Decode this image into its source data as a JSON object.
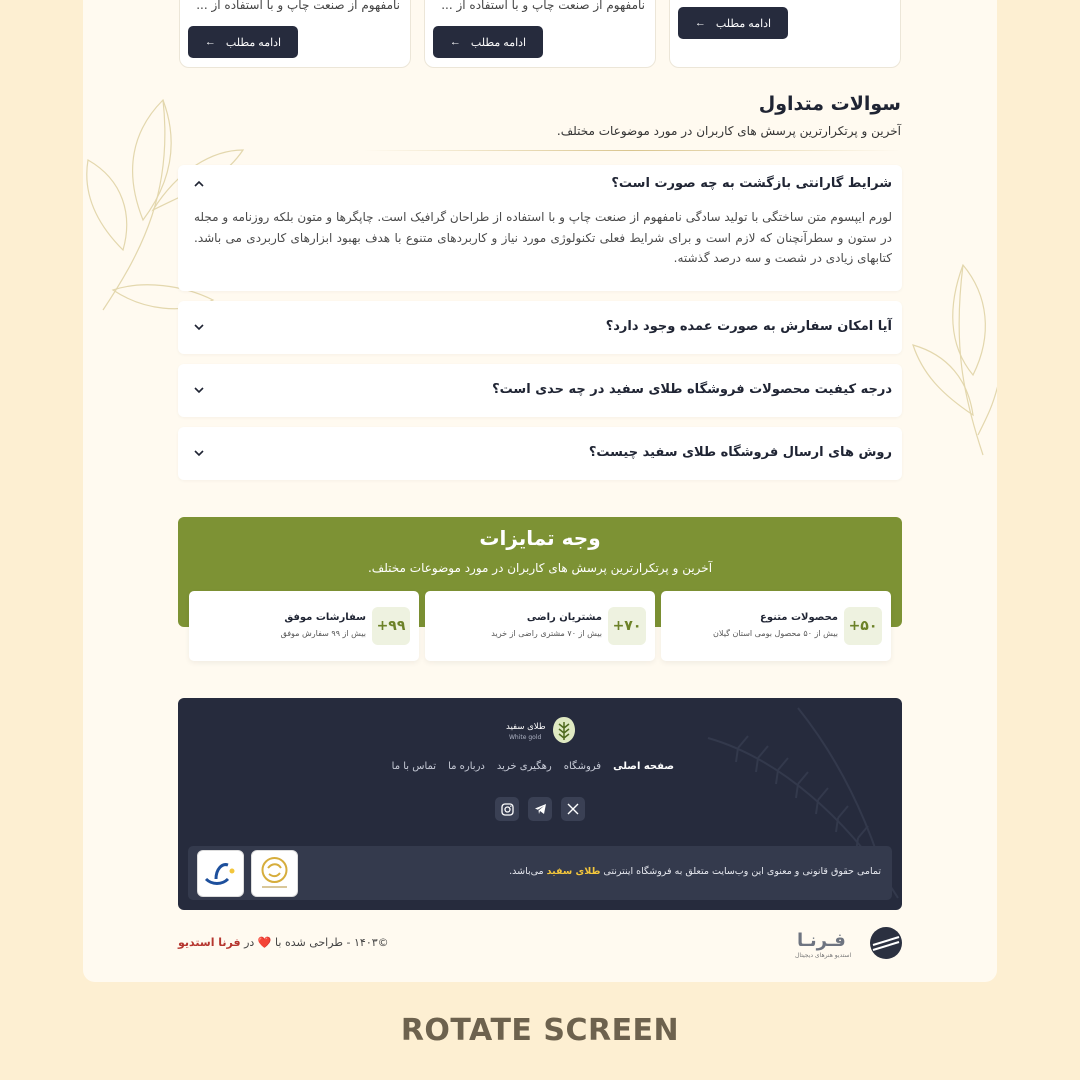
{
  "articles": [
    {
      "excerpt": "نامفهوم از صنعت چاپ و با استفاده از ...",
      "button": "ادامه مطلب"
    },
    {
      "excerpt": "نامفهوم از صنعت چاپ و با استفاده از ...",
      "button": "ادامه مطلب"
    },
    {
      "excerpt": "",
      "button": "ادامه مطلب"
    }
  ],
  "faq": {
    "title": "سوالات متداول",
    "subtitle": "آخرین و پرتکرارترین پرسش های کاربران در مورد موضوعات مختلف.",
    "items": [
      {
        "question": "شرایط گارانتی بازگشت به چه صورت است؟",
        "answer": "لورم ایپسوم متن ساختگی با تولید سادگی نامفهوم از صنعت چاپ و با استفاده از طراحان گرافیک است. چاپگرها و متون بلکه روزنامه و مجله در ستون و سطرآنچنان که لازم است و برای شرایط فعلی تکنولوژی مورد نیاز و کاربردهای متنوع با هدف بهبود ابزارهای کاربردی می باشد. کتابهای زیادی در شصت و سه درصد گذشته.",
        "open": true
      },
      {
        "question": "آیا امکان سفارش به صورت عمده وجود دارد؟",
        "answer": "",
        "open": false
      },
      {
        "question": "درجه کیفیت محصولات فروشگاه طلای سفید در چه حدی است؟",
        "answer": "",
        "open": false
      },
      {
        "question": "روش های ارسال فروشگاه طلای سفید چیست؟",
        "answer": "",
        "open": false
      }
    ]
  },
  "features": {
    "title": "وجه تمایزات",
    "subtitle": "آخرین و پرتکرارترین پرسش های کاربران در مورد موضوعات مختلف.",
    "items": [
      {
        "badge": "+۵۰",
        "name": "محصولات متنوع",
        "desc": "بیش از ۵۰ محصول بومی استان گیلان"
      },
      {
        "badge": "+۷۰",
        "name": "مشتریان راضی",
        "desc": "بیش از ۷۰ مشتری راضی از خرید"
      },
      {
        "badge": "+۹۹",
        "name": "سفارشات موفق",
        "desc": "بیش از ۹۹ سفارش موفق"
      }
    ]
  },
  "footer": {
    "logo_fa": "طلای سفید",
    "logo_en": "White gold",
    "nav": [
      "صفحه اصلی",
      "فروشگاه",
      "رهگیری خرید",
      "درباره ما",
      "تماس با ما"
    ],
    "copyright_before": "تمامی حقوق قانونی و معنوی این وب‌سایت متعلق به فروشگاه اینترنتی ",
    "copyright_brand": "طلای سفید",
    "copyright_after": " می‌باشد."
  },
  "credit": {
    "text_before": "©۱۴۰۳ - طراحی شده با ",
    "heart": "❤️",
    "text_mid": " در ",
    "studio": "فرنا استدیو",
    "studio_logo": "فـرنـا",
    "studio_tagline": "استدیو هنرهای دیجیتال"
  },
  "colors": {
    "accent_green": "#7d9234",
    "dark_navy": "#262b3d",
    "gold": "#f3c63c"
  },
  "rotate_label": "ROTATE SCREEN"
}
